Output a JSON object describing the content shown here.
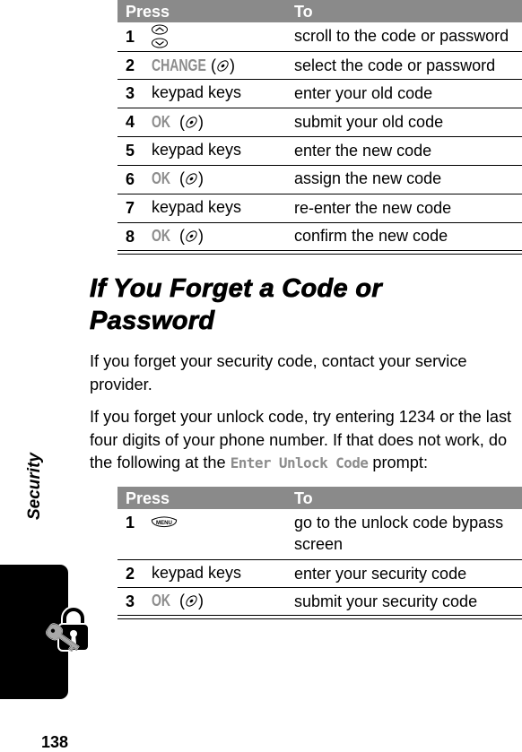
{
  "page": {
    "section_label": "Security",
    "page_number": "138",
    "section_icon": "lock-and-key-icon"
  },
  "table1": {
    "headers": {
      "press": "Press",
      "to": "To"
    },
    "rows": [
      {
        "num": "1",
        "press": {
          "type": "icon",
          "icon": "scroll-up-down-icon"
        },
        "to": "scroll to the code or password"
      },
      {
        "num": "2",
        "press": {
          "type": "softkey",
          "label": "CHANGE",
          "icon": "select-key-icon"
        },
        "to": "select the code or password"
      },
      {
        "num": "3",
        "press": {
          "type": "text",
          "label": "keypad keys"
        },
        "to": "enter your old code"
      },
      {
        "num": "4",
        "press": {
          "type": "softkey",
          "label": "OK",
          "icon": "select-key-icon"
        },
        "to": "submit your old code"
      },
      {
        "num": "5",
        "press": {
          "type": "text",
          "label": "keypad keys"
        },
        "to": "enter the new code"
      },
      {
        "num": "6",
        "press": {
          "type": "softkey",
          "label": "OK",
          "icon": "select-key-icon"
        },
        "to": "assign the new code"
      },
      {
        "num": "7",
        "press": {
          "type": "text",
          "label": "keypad keys"
        },
        "to": "re-enter the new code"
      },
      {
        "num": "8",
        "press": {
          "type": "softkey",
          "label": "OK",
          "icon": "select-key-icon"
        },
        "to": "confirm the new code"
      }
    ]
  },
  "section": {
    "heading_line1": "If You Forget a Code or",
    "heading_line2": "Password",
    "para1": "If you forget your security code, contact your service provider.",
    "para2_before": "If you forget your unlock code, try entering 1234 or the last four digits of your phone number. If that does not work, do the following at the ",
    "para2_prompt": "Enter Unlock Code",
    "para2_after": " prompt:"
  },
  "table2": {
    "headers": {
      "press": "Press",
      "to": "To"
    },
    "rows": [
      {
        "num": "1",
        "press": {
          "type": "icon",
          "icon": "menu-key-icon",
          "label": "MENU"
        },
        "to": "go to the unlock code bypass screen"
      },
      {
        "num": "2",
        "press": {
          "type": "text",
          "label": "keypad keys"
        },
        "to": "enter your security code"
      },
      {
        "num": "3",
        "press": {
          "type": "softkey",
          "label": "OK",
          "icon": "select-key-icon"
        },
        "to": "submit your security code"
      }
    ]
  }
}
